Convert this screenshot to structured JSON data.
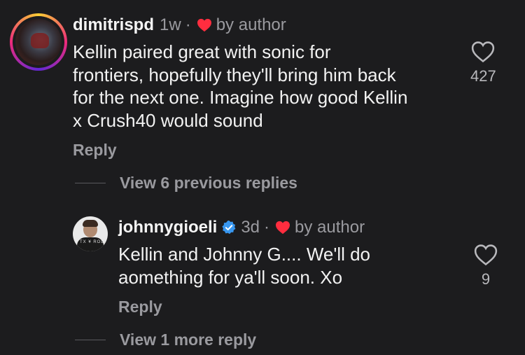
{
  "comment": {
    "username": "dimitrispd",
    "age": "1w",
    "separator": "·",
    "liked_by": "by author",
    "text_lines": [
      "Kellin paired great with sonic for",
      "frontiers, hopefully they'll bring him back",
      "for the next one. Imagine how good Kellin",
      "x Crush40 would sound"
    ],
    "like_count": "427",
    "reply_label": "Reply",
    "view_previous": "View 6 previous replies"
  },
  "reply": {
    "username": "johnnygioeli",
    "age": "3d",
    "separator": "·",
    "liked_by": "by author",
    "text_lines": [
      "Kellin and Johnny G.... We'll do",
      "aomething for ya'll soon. Xo"
    ],
    "like_count": "9",
    "reply_label": "Reply",
    "view_more": "View 1 more reply",
    "avatar_shirt_text": "TX ¥ ROLL"
  },
  "colors": {
    "background": "#1c1c1e",
    "muted": "#9a9a9f",
    "heart_red": "#ff2d3f",
    "verified_blue": "#3897f0"
  }
}
